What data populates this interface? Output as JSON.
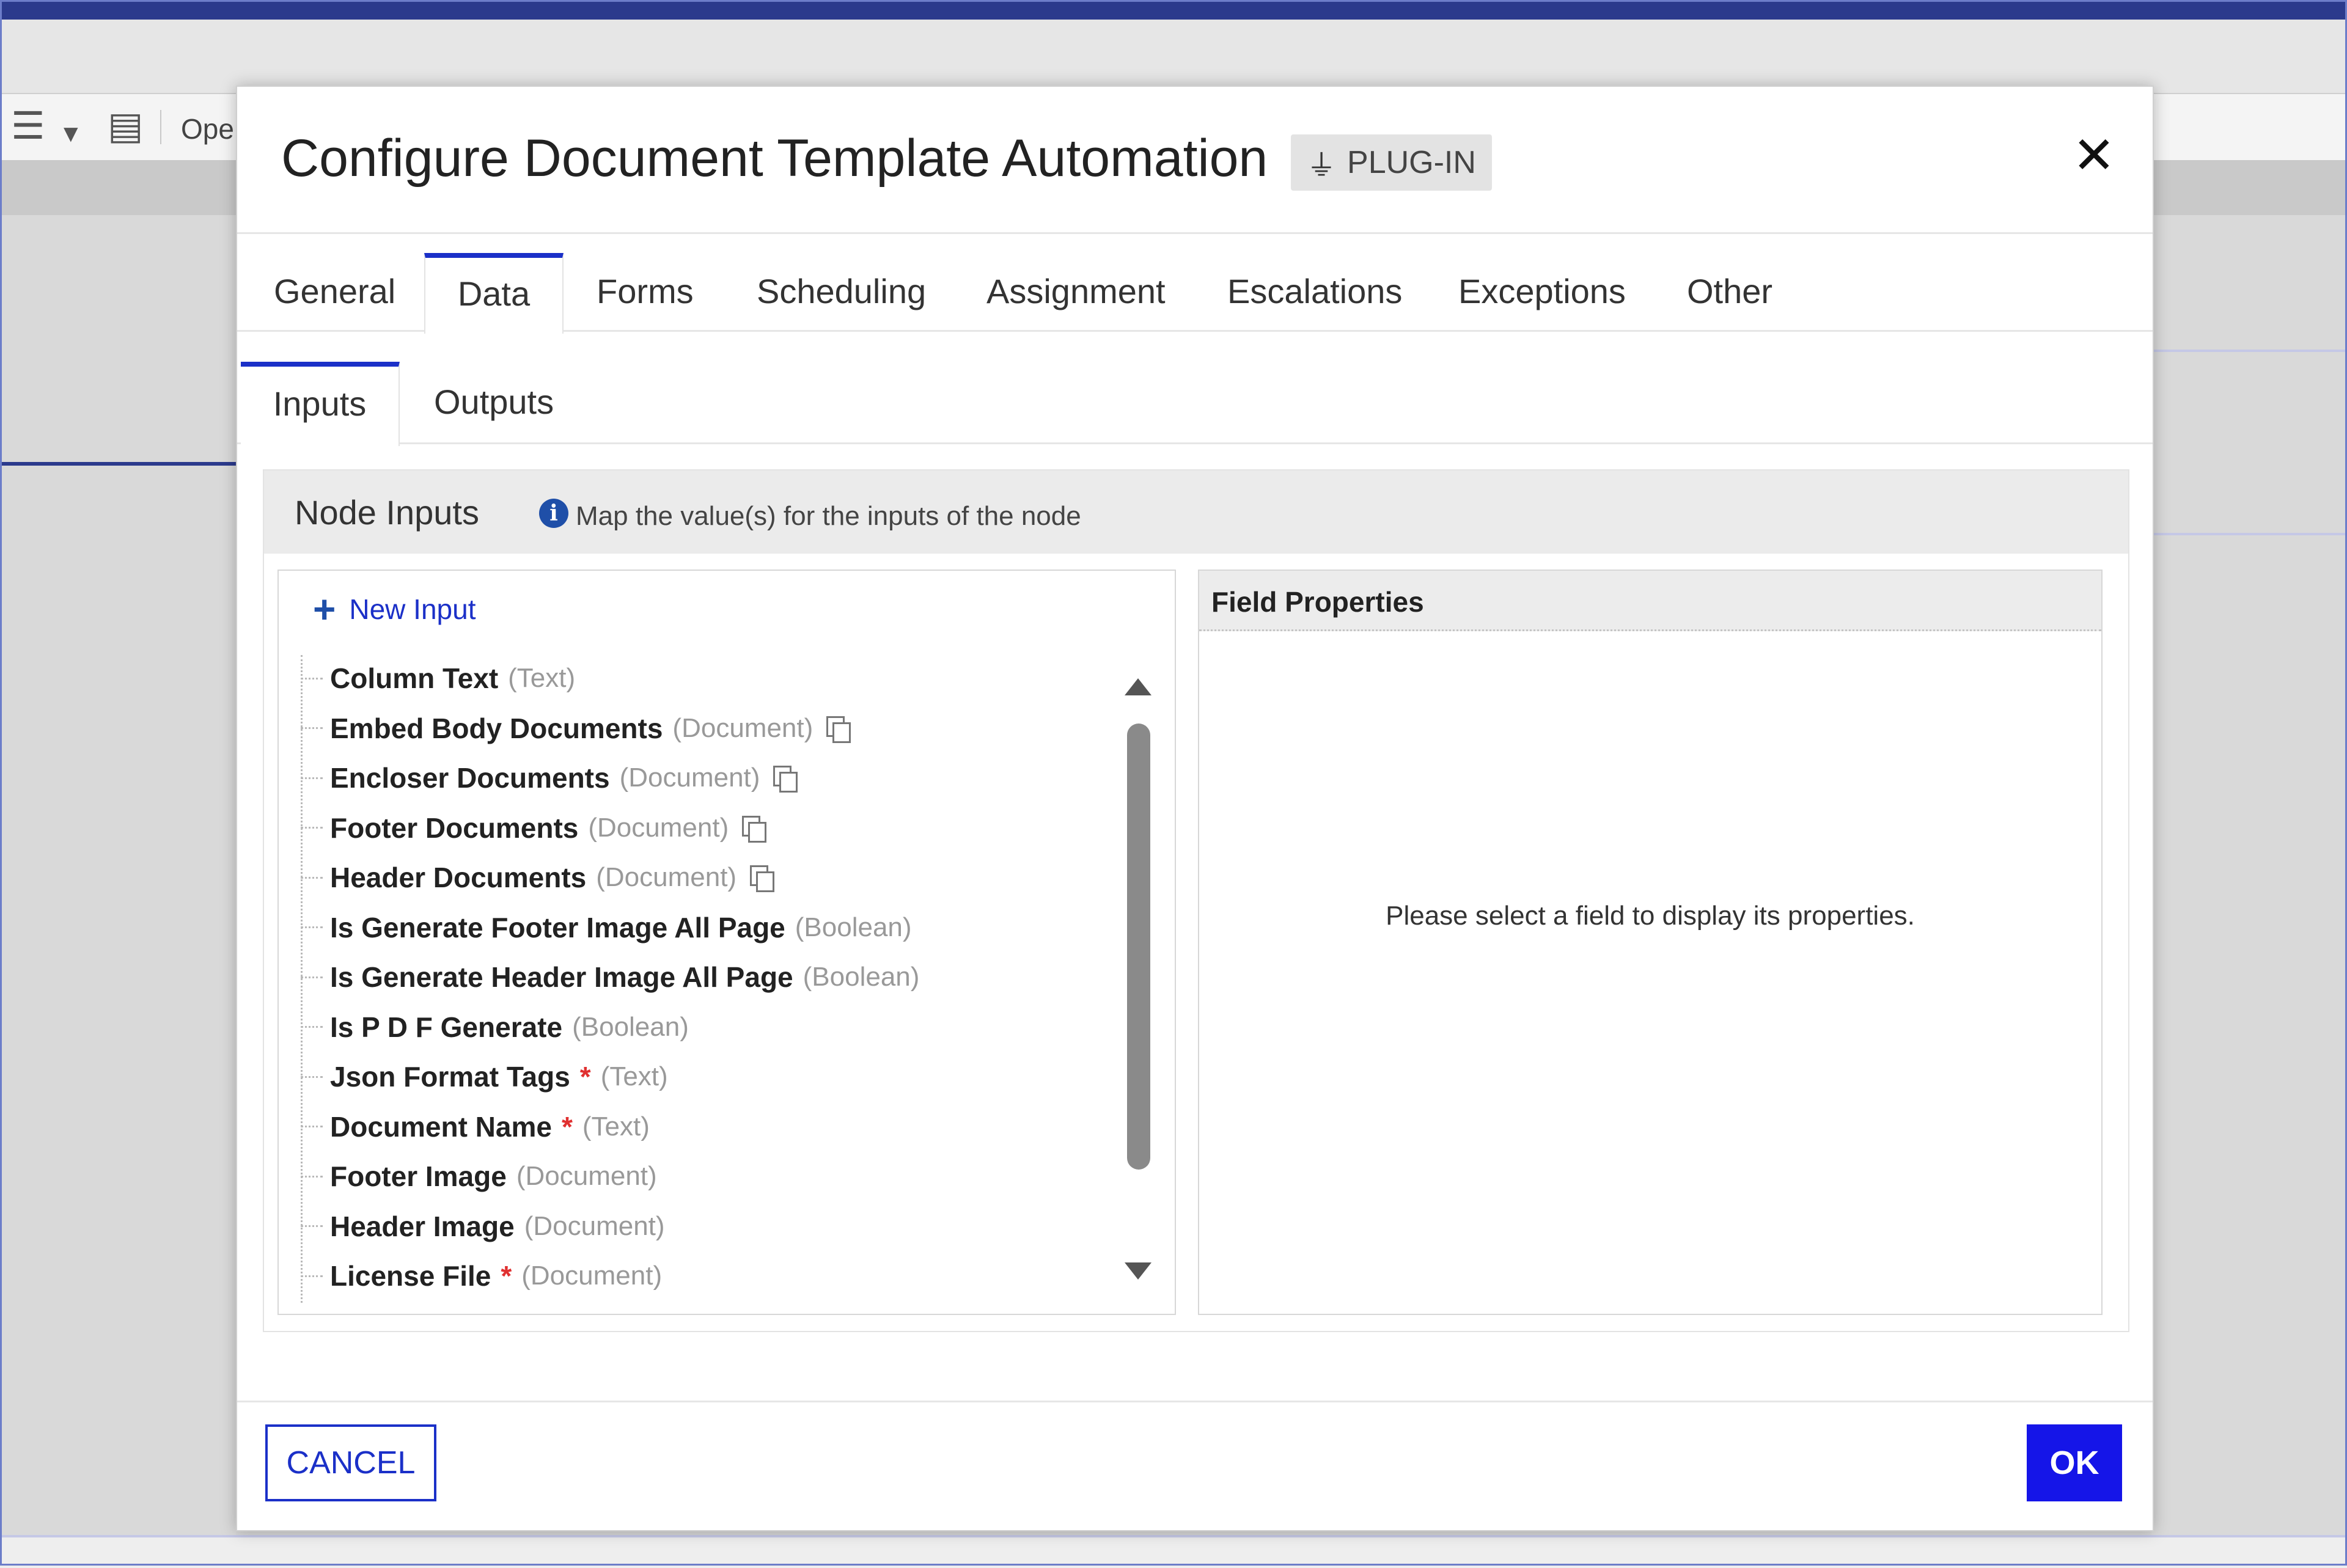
{
  "background": {
    "toolbar_text": "Ope"
  },
  "dialog": {
    "title": "Configure Document Template Automation",
    "badge": "PLUG-IN",
    "tabs": [
      {
        "label": "General"
      },
      {
        "label": "Data"
      },
      {
        "label": "Forms"
      },
      {
        "label": "Scheduling"
      },
      {
        "label": "Assignment"
      },
      {
        "label": "Escalations"
      },
      {
        "label": "Exceptions"
      },
      {
        "label": "Other"
      }
    ],
    "active_tab": "Data",
    "subtabs": [
      {
        "label": "Inputs"
      },
      {
        "label": "Outputs"
      }
    ],
    "active_subtab": "Inputs",
    "node_inputs": {
      "title": "Node Inputs",
      "info": "Map the value(s) for the inputs of the node",
      "new_input_label": "New Input",
      "fields": [
        {
          "name": "Column Text",
          "type": "(Text)",
          "required": false,
          "copy": false
        },
        {
          "name": "Embed Body Documents",
          "type": "(Document)",
          "required": false,
          "copy": true
        },
        {
          "name": "Encloser Documents",
          "type": "(Document)",
          "required": false,
          "copy": true
        },
        {
          "name": "Footer Documents",
          "type": "(Document)",
          "required": false,
          "copy": true
        },
        {
          "name": "Header Documents",
          "type": "(Document)",
          "required": false,
          "copy": true
        },
        {
          "name": "Is Generate Footer Image All Page",
          "type": "(Boolean)",
          "required": false,
          "copy": false
        },
        {
          "name": "Is Generate Header Image All Page",
          "type": "(Boolean)",
          "required": false,
          "copy": false
        },
        {
          "name": "Is P D F Generate",
          "type": "(Boolean)",
          "required": false,
          "copy": false
        },
        {
          "name": "Json Format Tags",
          "type": "(Text)",
          "required": true,
          "copy": false
        },
        {
          "name": "Document Name",
          "type": "(Text)",
          "required": true,
          "copy": false
        },
        {
          "name": "Footer Image",
          "type": "(Document)",
          "required": false,
          "copy": false
        },
        {
          "name": "Header Image",
          "type": "(Document)",
          "required": false,
          "copy": false
        },
        {
          "name": "License File",
          "type": "(Document)",
          "required": true,
          "copy": false
        }
      ]
    },
    "field_properties": {
      "title": "Field Properties",
      "empty_message": "Please select a field to display its properties."
    },
    "footer": {
      "cancel_label": "CANCEL",
      "ok_label": "OK"
    },
    "colors": {
      "accent": "#1b30c8",
      "ok_button": "#1515e8",
      "required_marker": "#e03030"
    }
  }
}
